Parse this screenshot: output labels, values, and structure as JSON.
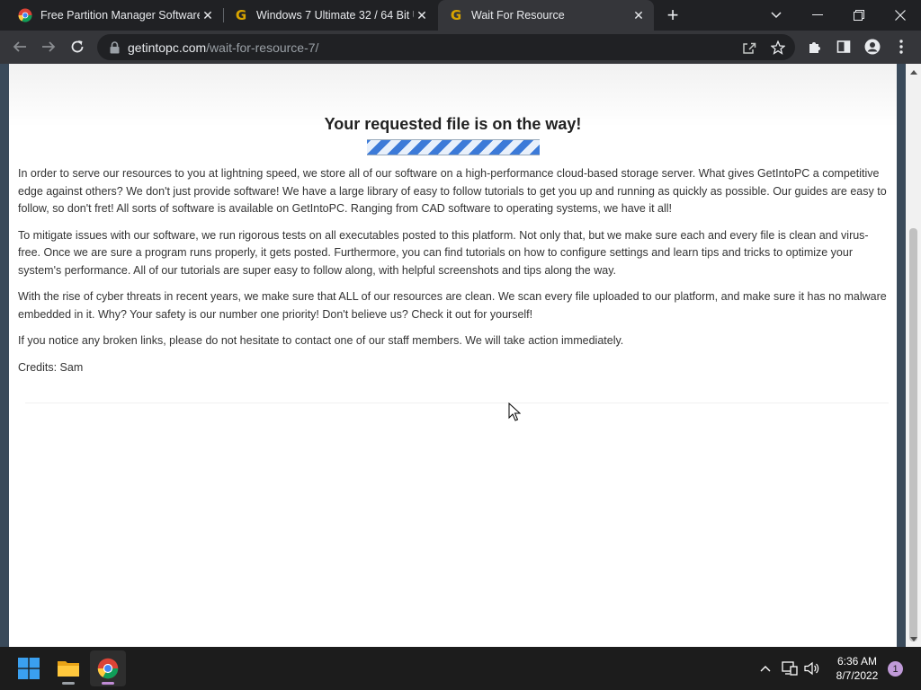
{
  "browser": {
    "tabs": [
      {
        "title": "Free Partition Manager Software",
        "favicon": "chrome-multicolor-icon",
        "active": false
      },
      {
        "title": "Windows 7 Ultimate 32 / 64 Bit U",
        "favicon": "getintopc-g-icon",
        "active": false
      },
      {
        "title": "Wait For Resource",
        "favicon": "getintopc-g-icon",
        "active": true
      }
    ],
    "new_tab_label": "+",
    "tab_favicon_letter": "G",
    "address": {
      "domain": "getintopc.com",
      "path": "/wait-for-resource-7/"
    }
  },
  "page": {
    "headline": "Your requested file is on the way!",
    "progress_state": "indeterminate",
    "paragraphs": [
      "In order to serve our resources to you at lightning speed, we store all of our software on a high-performance cloud-based storage server. What gives GetIntoPC a competitive edge against others? We don't just provide software! We have a large library of easy to follow tutorials to get you up and running as quickly as possible. Our guides are easy to follow, so don't fret! All sorts of software is available on GetIntoPC. Ranging from CAD software to operating systems, we have it all!",
      "To mitigate issues with our software, we run rigorous tests on all executables posted to this platform. Not only that, but we make sure each and every file is clean and virus-free. Once we are sure a program runs properly, it gets posted. Furthermore, you can find tutorials on how to configure settings and learn tips and tricks to optimize your system's performance. All of our tutorials are super easy to follow along, with helpful screenshots and tips along the way.",
      "With the rise of cyber threats in recent years, we make sure that ALL of our resources are clean. We scan every file uploaded to our platform, and make sure it has no malware embedded in it. Why? Your safety is our number one priority! Don't believe us? Check it out for yourself!",
      "If you notice any broken links, please do not hesitate to contact one of our staff members. We will take action immediately.",
      "Credits: Sam"
    ]
  },
  "taskbar": {
    "apps": [
      "start-windows-icon",
      "file-explorer-icon",
      "chrome-icon"
    ],
    "time": "6:36 AM",
    "date": "8/7/2022",
    "notification_count": "1"
  },
  "colors": {
    "chrome_dark": "#202124",
    "toolbar": "#35363a",
    "progress_blue": "#3c7ad8",
    "taskbar": "#1c1c1c"
  }
}
